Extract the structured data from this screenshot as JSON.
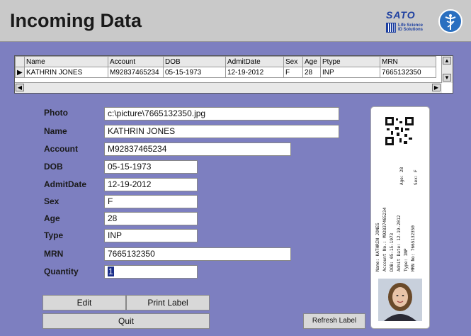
{
  "header": {
    "title": "Incoming Data",
    "logo_brand": "SATO",
    "logo_line1": "Life Science",
    "logo_line2": "ID Solutions"
  },
  "grid": {
    "columns": [
      "Name",
      "Account",
      "DOB",
      "AdmitDate",
      "Sex",
      "Age",
      "Ptype",
      "MRN"
    ],
    "row": [
      "KATHRIN JONES",
      "M92837465234",
      "05-15-1973",
      "12-19-2012",
      "F",
      "28",
      "INP",
      "7665132350"
    ]
  },
  "form": {
    "photo_label": "Photo",
    "photo_value": "c:\\picture\\7665132350.jpg",
    "name_label": "Name",
    "name_value": "KATHRIN JONES",
    "account_label": "Account",
    "account_value": "M92837465234",
    "dob_label": "DOB",
    "dob_value": "05-15-1973",
    "admit_label": "AdmitDate",
    "admit_value": "12-19-2012",
    "sex_label": "Sex",
    "sex_value": "F",
    "age_label": "Age",
    "age_value": "28",
    "type_label": "Type",
    "type_value": "INP",
    "mrn_label": "MRN",
    "mrn_value": "7665132350",
    "quantity_label": "Quantity",
    "quantity_value": "1"
  },
  "buttons": {
    "edit": "Edit",
    "print_label": "Print Label",
    "quit": "Quit",
    "refresh_label": "Refresh Label"
  },
  "label_preview": {
    "age_line": "Age: 28",
    "sex_line": "Sex: F",
    "name_line": "Name: KATHRIN JONES",
    "account_line": "Account No.: M92837465234",
    "dob_line": "DOB: 05-15-1973",
    "admit_line": "Admit Date: 12-19-2012",
    "type_line": "Type: INP",
    "mrn_line": "MRN No: 7665132350"
  },
  "colors": {
    "background": "#7d7fc0",
    "header": "#c9c9c9",
    "accent": "#1d3fa0"
  }
}
